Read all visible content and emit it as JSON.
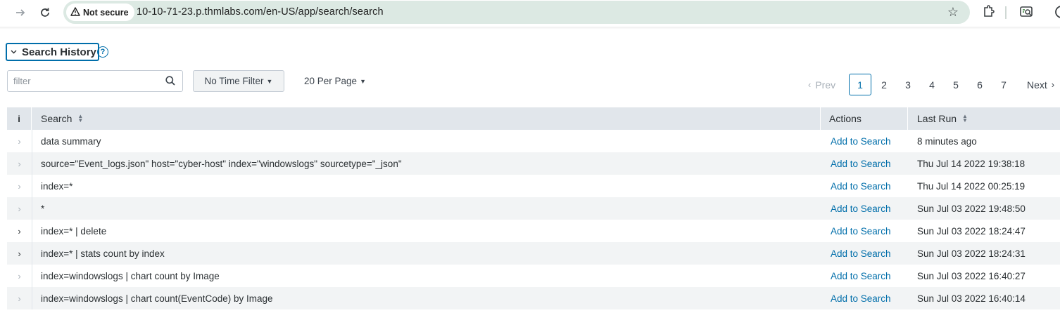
{
  "browser": {
    "security_label": "Not secure",
    "url": "10-10-71-23.p.thmlabs.com/en-US/app/search/search"
  },
  "header": {
    "title": "Search History",
    "help_glyph": "?"
  },
  "controls": {
    "filter_placeholder": "filter",
    "time_filter_label": "No Time Filter",
    "per_page_label": "20 Per Page"
  },
  "pagination": {
    "prev_label": "Prev",
    "next_label": "Next",
    "pages": [
      "1",
      "2",
      "3",
      "4",
      "5",
      "6",
      "7"
    ],
    "current_page": "1"
  },
  "table": {
    "columns": {
      "info": "i",
      "search": "Search",
      "actions": "Actions",
      "last_run": "Last Run"
    },
    "rows": [
      {
        "search": "data summary",
        "action": "Add to Search",
        "last_run": "8 minutes ago"
      },
      {
        "search": "source=\"Event_logs.json\" host=\"cyber-host\" index=\"windowslogs\" sourcetype=\"_json\"",
        "action": "Add to Search",
        "last_run": "Thu Jul 14 2022 19:38:18"
      },
      {
        "search": "index=*",
        "action": "Add to Search",
        "last_run": "Thu Jul 14 2022 00:25:19"
      },
      {
        "search": "*",
        "action": "Add to Search",
        "last_run": "Sun Jul 03 2022 19:48:50"
      },
      {
        "search": "index=* | delete",
        "action": "Add to Search",
        "last_run": "Sun Jul 03 2022 18:24:47"
      },
      {
        "search": "index=* | stats count by index",
        "action": "Add to Search",
        "last_run": "Sun Jul 03 2022 18:24:31"
      },
      {
        "search": "index=windowslogs | chart count by Image",
        "action": "Add to Search",
        "last_run": "Sun Jul 03 2022 16:40:27"
      },
      {
        "search": "index=windowslogs | chart count(EventCode) by Image",
        "action": "Add to Search",
        "last_run": "Sun Jul 03 2022 16:40:14"
      }
    ]
  }
}
